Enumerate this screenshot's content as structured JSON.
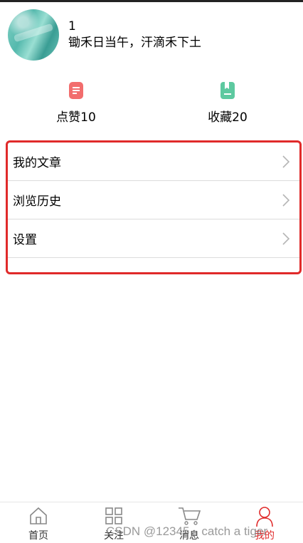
{
  "profile": {
    "username": "1",
    "motto": "锄禾日当午，汗滴禾下土"
  },
  "stats": {
    "likes_label": "点赞10",
    "favorites_label": "收藏20",
    "likes_icon_color": "#f26d6d",
    "favorites_icon_color": "#5dc9a0"
  },
  "menu": {
    "items": [
      {
        "label": "我的文章"
      },
      {
        "label": "浏览历史"
      },
      {
        "label": "设置"
      }
    ],
    "highlight_color": "#e02a2a"
  },
  "tabbar": {
    "tabs": [
      {
        "label": "首页",
        "icon": "home-icon"
      },
      {
        "label": "关注",
        "icon": "grid-icon"
      },
      {
        "label": "消息",
        "icon": "cart-icon"
      },
      {
        "label": "我的",
        "icon": "user-icon",
        "active": true
      }
    ],
    "active_color": "#e02a2a"
  },
  "watermark": "CSDN @12345，catch a tiger"
}
